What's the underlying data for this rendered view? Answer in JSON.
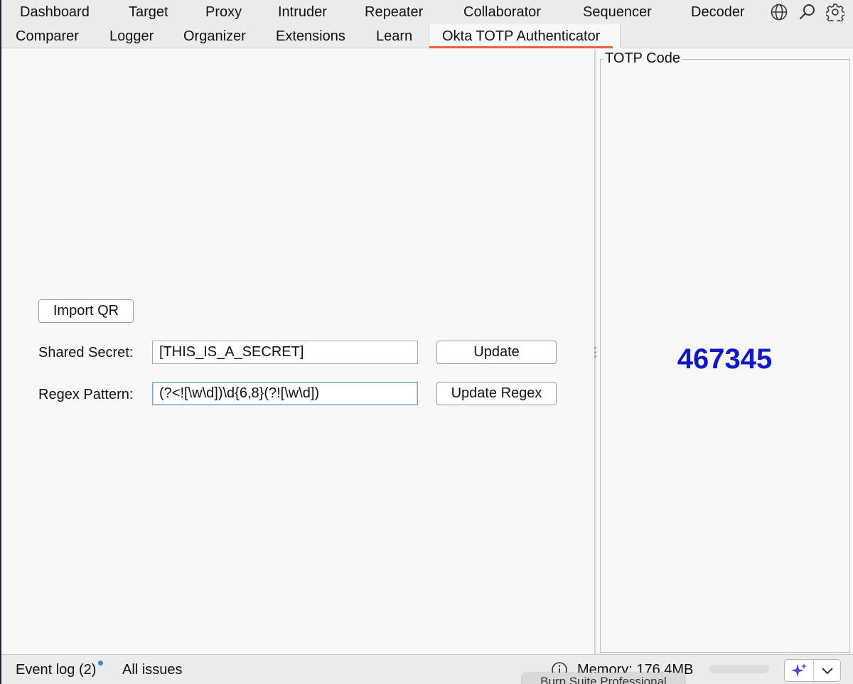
{
  "tabs": {
    "row1": [
      "Dashboard",
      "Target",
      "Proxy",
      "Intruder",
      "Repeater",
      "Collaborator",
      "Sequencer",
      "Decoder"
    ],
    "row2": [
      "Comparer",
      "Logger",
      "Organizer",
      "Extensions",
      "Learn",
      "Okta TOTP Authenticator"
    ],
    "active": "Okta TOTP Authenticator"
  },
  "top_icons": [
    "globe-icon",
    "search-icon",
    "gear-icon"
  ],
  "form": {
    "import_qr_label": "Import QR",
    "shared_secret_label": "Shared Secret:",
    "shared_secret_value": "[THIS_IS_A_SECRET]",
    "update_label": "Update",
    "regex_label": "Regex Pattern:",
    "regex_value": "(?<![\\w\\d])\\d{6,8}(?![\\w\\d])",
    "update_regex_label": "Update Regex"
  },
  "totp": {
    "title": "TOTP Code",
    "code": "467345",
    "code_color": "#0f17c8"
  },
  "status": {
    "event_log": "Event log (2)",
    "all_issues": "All issues",
    "memory": "Memory: 176.4MB",
    "app_tooltip": "Burp Suite Professional"
  },
  "colors": {
    "active_tab_underline": "#e8643b",
    "notification_dot": "#2e8ae6",
    "ai_icon": "#5b3fd6"
  }
}
